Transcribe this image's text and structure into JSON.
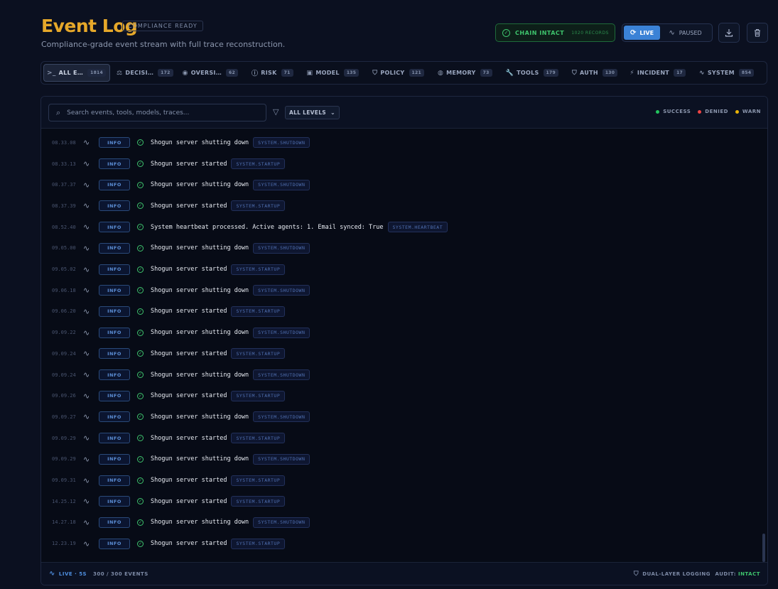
{
  "header": {
    "title": "Event Log",
    "badge": "COMPLIANCE READY",
    "subtitle": "Compliance-grade event stream with full trace reconstruction.",
    "chain_label": "CHAIN INTACT",
    "chain_records": "1020 RECORDS",
    "live_label": "LIVE",
    "paused_label": "PAUSED"
  },
  "tabs": [
    {
      "label": "ALL E…",
      "count": "1814",
      "icon": "terminal-icon",
      "glyph": ">_"
    },
    {
      "label": "DECISI…",
      "count": "172",
      "icon": "scale-icon",
      "glyph": "⚖"
    },
    {
      "label": "OVERSI…",
      "count": "62",
      "icon": "eye-icon",
      "glyph": "◉"
    },
    {
      "label": "RISK",
      "count": "71",
      "icon": "alert-icon",
      "glyph": "ⓘ"
    },
    {
      "label": "MODEL",
      "count": "135",
      "icon": "cpu-icon",
      "glyph": "▣"
    },
    {
      "label": "POLICY",
      "count": "121",
      "icon": "shield-icon",
      "glyph": "⛉"
    },
    {
      "label": "MEMORY",
      "count": "73",
      "icon": "database-icon",
      "glyph": "◍"
    },
    {
      "label": "TOOLS",
      "count": "179",
      "icon": "wrench-icon",
      "glyph": "🔧"
    },
    {
      "label": "AUTH",
      "count": "130",
      "icon": "lock-icon",
      "glyph": "⛉"
    },
    {
      "label": "INCIDENT",
      "count": "17",
      "icon": "zap-icon",
      "glyph": "⚡"
    },
    {
      "label": "SYSTEM",
      "count": "854",
      "icon": "pulse-icon",
      "glyph": "∿"
    }
  ],
  "toolbar": {
    "search_placeholder": "Search events, tools, models, traces...",
    "level_select": "ALL LEVELS",
    "legend": [
      {
        "label": "SUCCESS",
        "color": "#22c55e"
      },
      {
        "label": "DENIED",
        "color": "#ef4444"
      },
      {
        "label": "WARN",
        "color": "#eab308"
      }
    ]
  },
  "events": [
    {
      "time": "08.33.08",
      "level": "INFO",
      "message": "Shogun server shutting down",
      "tag": "SYSTEM.SHUTDOWN"
    },
    {
      "time": "08.33.13",
      "level": "INFO",
      "message": "Shogun server started",
      "tag": "SYSTEM.STARTUP"
    },
    {
      "time": "08.37.37",
      "level": "INFO",
      "message": "Shogun server shutting down",
      "tag": "SYSTEM.SHUTDOWN"
    },
    {
      "time": "08.37.39",
      "level": "INFO",
      "message": "Shogun server started",
      "tag": "SYSTEM.STARTUP"
    },
    {
      "time": "08.52.40",
      "level": "INFO",
      "message": "System heartbeat processed. Active agents: 1. Email synced: True",
      "tag": "SYSTEM.HEARTBEAT"
    },
    {
      "time": "09.05.00",
      "level": "INFO",
      "message": "Shogun server shutting down",
      "tag": "SYSTEM.SHUTDOWN"
    },
    {
      "time": "09.05.02",
      "level": "INFO",
      "message": "Shogun server started",
      "tag": "SYSTEM.STARTUP"
    },
    {
      "time": "09.06.18",
      "level": "INFO",
      "message": "Shogun server shutting down",
      "tag": "SYSTEM.SHUTDOWN"
    },
    {
      "time": "09.06.20",
      "level": "INFO",
      "message": "Shogun server started",
      "tag": "SYSTEM.STARTUP"
    },
    {
      "time": "09.09.22",
      "level": "INFO",
      "message": "Shogun server shutting down",
      "tag": "SYSTEM.SHUTDOWN"
    },
    {
      "time": "09.09.24",
      "level": "INFO",
      "message": "Shogun server started",
      "tag": "SYSTEM.STARTUP"
    },
    {
      "time": "09.09.24",
      "level": "INFO",
      "message": "Shogun server shutting down",
      "tag": "SYSTEM.SHUTDOWN"
    },
    {
      "time": "09.09.26",
      "level": "INFO",
      "message": "Shogun server started",
      "tag": "SYSTEM.STARTUP"
    },
    {
      "time": "09.09.27",
      "level": "INFO",
      "message": "Shogun server shutting down",
      "tag": "SYSTEM.SHUTDOWN"
    },
    {
      "time": "09.09.29",
      "level": "INFO",
      "message": "Shogun server started",
      "tag": "SYSTEM.STARTUP"
    },
    {
      "time": "09.09.29",
      "level": "INFO",
      "message": "Shogun server shutting down",
      "tag": "SYSTEM.SHUTDOWN"
    },
    {
      "time": "09.09.31",
      "level": "INFO",
      "message": "Shogun server started",
      "tag": "SYSTEM.STARTUP"
    },
    {
      "time": "14.25.12",
      "level": "INFO",
      "message": "Shogun server started",
      "tag": "SYSTEM.STARTUP"
    },
    {
      "time": "14.27.18",
      "level": "INFO",
      "message": "Shogun server shutting down",
      "tag": "SYSTEM.SHUTDOWN"
    },
    {
      "time": "12.23.19",
      "level": "INFO",
      "message": "Shogun server started",
      "tag": "SYSTEM.STARTUP"
    }
  ],
  "footer": {
    "live": "LIVE · 5S",
    "events": "300 / 300 EVENTS",
    "dual": "DUAL-LAYER LOGGING",
    "audit_label": "AUDIT:",
    "audit_value": "INTACT"
  }
}
